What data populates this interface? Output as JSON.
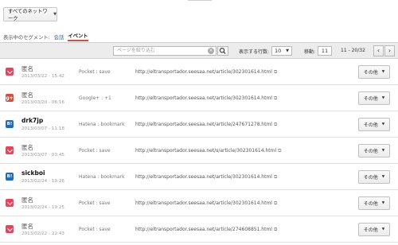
{
  "network_filter": {
    "label": "すべてのネットワーク"
  },
  "segment": {
    "label": "表示中のセグメント:",
    "option_conversation": "会話",
    "option_events": "イベント"
  },
  "toolbar": {
    "search_placeholder": "ページを絞り込む",
    "rows_label": "表示する行数:",
    "rows_value": "10",
    "move_label": "移動:",
    "move_value": "11",
    "range": "11 - 20/32"
  },
  "rows": [
    {
      "icon": "pocket-icon",
      "name": "匿名",
      "date": "2013/03/22 - 15:42",
      "action": "Pocket : save",
      "url": "http://eltransportador.seesaa.net/article/302301614.html",
      "more": "その他"
    },
    {
      "icon": "google-plus-icon",
      "name": "匿名",
      "date": "2013/03/20 - 06:16",
      "action": "Google+ : +1",
      "url": "http://eltransportador.seesaa.net/article/302301614.html",
      "more": "その他"
    },
    {
      "icon": "hatena-icon",
      "name": "drk7jp",
      "date": "2013/03/07 - 11:18",
      "action": "Hatena : bookmark",
      "url": "http://eltransportador.seesaa.net/article/247671278.html",
      "more": "その他"
    },
    {
      "icon": "pocket-icon",
      "name": "匿名",
      "date": "2013/03/07 - 03:45",
      "action": "Pocket : save",
      "url": "http://eltransportador.seesaa.net/s/article/302301614.html",
      "more": "その他"
    },
    {
      "icon": "hatena-icon",
      "name": "sickboi",
      "date": "2013/02/24 - 19:26",
      "action": "Hatena : bookmark",
      "url": "http://eltransportador.seesaa.net/article/302301614.html",
      "more": "その他"
    },
    {
      "icon": "pocket-icon",
      "name": "匿名",
      "date": "2013/02/24 - 19:25",
      "action": "Pocket : save",
      "url": "http://eltransportador.seesaa.net/article/302301614.html",
      "more": "その他"
    },
    {
      "icon": "pocket-icon",
      "name": "匿名",
      "date": "2013/02/22 - 22:43",
      "action": "Pocket : save",
      "url": "http://eltransportador.seesaa.net/article/274608851.html",
      "more": "その他"
    }
  ]
}
